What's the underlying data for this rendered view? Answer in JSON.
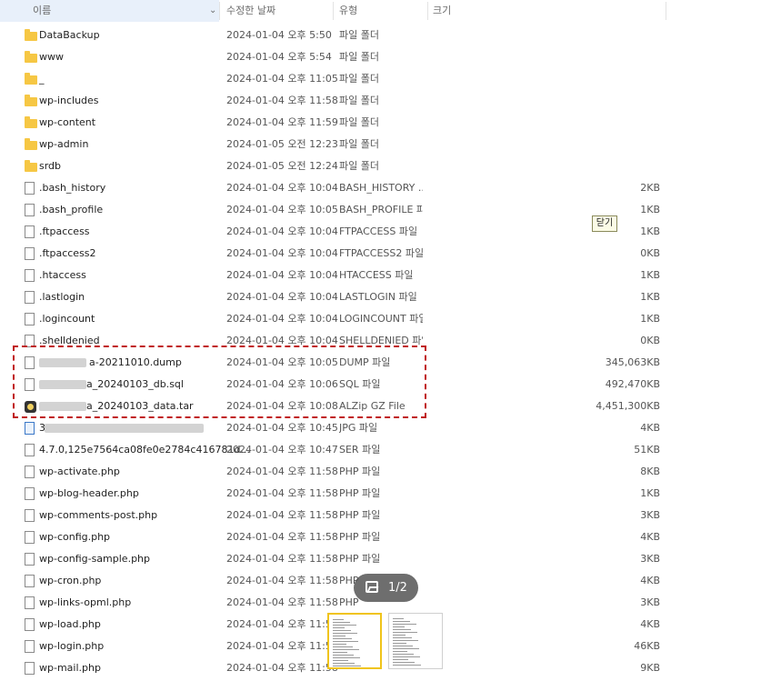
{
  "header": {
    "name": "이름",
    "date": "수정한 날짜",
    "type": "유형",
    "size": "크기"
  },
  "rows": [
    {
      "name": "DataBackup",
      "date": "2024-01-04 오후 5:50",
      "type": "파일 폴더",
      "size": "",
      "icon": "folder-icon"
    },
    {
      "name": "www",
      "date": "2024-01-04 오후 5:54",
      "type": "파일 폴더",
      "size": "",
      "icon": "folder-icon"
    },
    {
      "name": "_",
      "date": "2024-01-04 오후 11:05",
      "type": "파일 폴더",
      "size": "",
      "icon": "folder-icon"
    },
    {
      "name": "wp-includes",
      "date": "2024-01-04 오후 11:58",
      "type": "파일 폴더",
      "size": "",
      "icon": "folder-icon"
    },
    {
      "name": "wp-content",
      "date": "2024-01-04 오후 11:59",
      "type": "파일 폴더",
      "size": "",
      "icon": "folder-icon"
    },
    {
      "name": "wp-admin",
      "date": "2024-01-05 오전 12:23",
      "type": "파일 폴더",
      "size": "",
      "icon": "folder-icon"
    },
    {
      "name": "srdb",
      "date": "2024-01-05 오전 12:24",
      "type": "파일 폴더",
      "size": "",
      "icon": "folder-icon"
    },
    {
      "name": ".bash_history",
      "date": "2024-01-04 오후 10:04",
      "type": "BASH_HISTORY ...",
      "size": "2KB",
      "icon": "file-icon"
    },
    {
      "name": ".bash_profile",
      "date": "2024-01-04 오후 10:05",
      "type": "BASH_PROFILE 파...",
      "size": "1KB",
      "icon": "file-icon"
    },
    {
      "name": ".ftpaccess",
      "date": "2024-01-04 오후 10:04",
      "type": "FTPACCESS 파일",
      "size": "1KB",
      "icon": "file-icon"
    },
    {
      "name": ".ftpaccess2",
      "date": "2024-01-04 오후 10:04",
      "type": "FTPACCESS2 파일",
      "size": "0KB",
      "icon": "file-icon"
    },
    {
      "name": ".htaccess",
      "date": "2024-01-04 오후 10:04",
      "type": "HTACCESS 파일",
      "size": "1KB",
      "icon": "file-icon"
    },
    {
      "name": ".lastlogin",
      "date": "2024-01-04 오후 10:04",
      "type": "LASTLOGIN 파일",
      "size": "1KB",
      "icon": "file-icon"
    },
    {
      "name": ".logincount",
      "date": "2024-01-04 오후 10:04",
      "type": "LOGINCOUNT 파일",
      "size": "1KB",
      "icon": "file-icon"
    },
    {
      "name": ".shelldenied",
      "date": "2024-01-04 오후 10:04",
      "type": "SHELLDENIED 파일",
      "size": "0KB",
      "icon": "file-icon"
    },
    {
      "name": "a-20211010.dump",
      "date": "2024-01-04 오후 10:05",
      "type": "DUMP 파일",
      "size": "345,063KB",
      "icon": "file-icon"
    },
    {
      "name": "a_20240103_db.sql",
      "date": "2024-01-04 오후 10:06",
      "type": "SQL 파일",
      "size": "492,470KB",
      "icon": "file-icon"
    },
    {
      "name": "a_20240103_data.tar",
      "date": "2024-01-04 오후 10:08",
      "type": "ALZip GZ File",
      "size": "4,451,300KB",
      "icon": "alzip-icon"
    },
    {
      "name": "3",
      "date": "2024-01-04 오후 10:45",
      "type": "JPG 파일",
      "size": "4KB",
      "icon": "image-file-icon"
    },
    {
      "name": "4.7.0,125e7564ca08fe0e2784c416781d...",
      "date": "2024-01-04 오후 10:47",
      "type": "SER 파일",
      "size": "51KB",
      "icon": "file-icon"
    },
    {
      "name": "wp-activate.php",
      "date": "2024-01-04 오후 11:58",
      "type": "PHP 파일",
      "size": "8KB",
      "icon": "file-icon"
    },
    {
      "name": "wp-blog-header.php",
      "date": "2024-01-04 오후 11:58",
      "type": "PHP 파일",
      "size": "1KB",
      "icon": "file-icon"
    },
    {
      "name": "wp-comments-post.php",
      "date": "2024-01-04 오후 11:58",
      "type": "PHP 파일",
      "size": "3KB",
      "icon": "file-icon"
    },
    {
      "name": "wp-config.php",
      "date": "2024-01-04 오후 11:58",
      "type": "PHP 파일",
      "size": "4KB",
      "icon": "file-icon"
    },
    {
      "name": "wp-config-sample.php",
      "date": "2024-01-04 오후 11:58",
      "type": "PHP 파일",
      "size": "3KB",
      "icon": "file-icon"
    },
    {
      "name": "wp-cron.php",
      "date": "2024-01-04 오후 11:58",
      "type": "PHP",
      "size": "4KB",
      "icon": "file-icon"
    },
    {
      "name": "wp-links-opml.php",
      "date": "2024-01-04 오후 11:58",
      "type": "PHP",
      "size": "3KB",
      "icon": "file-icon"
    },
    {
      "name": "wp-load.php",
      "date": "2024-01-04 오후 11:58",
      "type": "",
      "size": "4KB",
      "icon": "file-icon"
    },
    {
      "name": "wp-login.php",
      "date": "2024-01-04 오후 11:58",
      "type": "",
      "size": "46KB",
      "icon": "file-icon"
    },
    {
      "name": "wp-mail.php",
      "date": "2024-01-04 오후 11:58",
      "type": "",
      "size": "9KB",
      "icon": "file-icon"
    }
  ],
  "close_label": "닫기",
  "image_counter": "1/2"
}
